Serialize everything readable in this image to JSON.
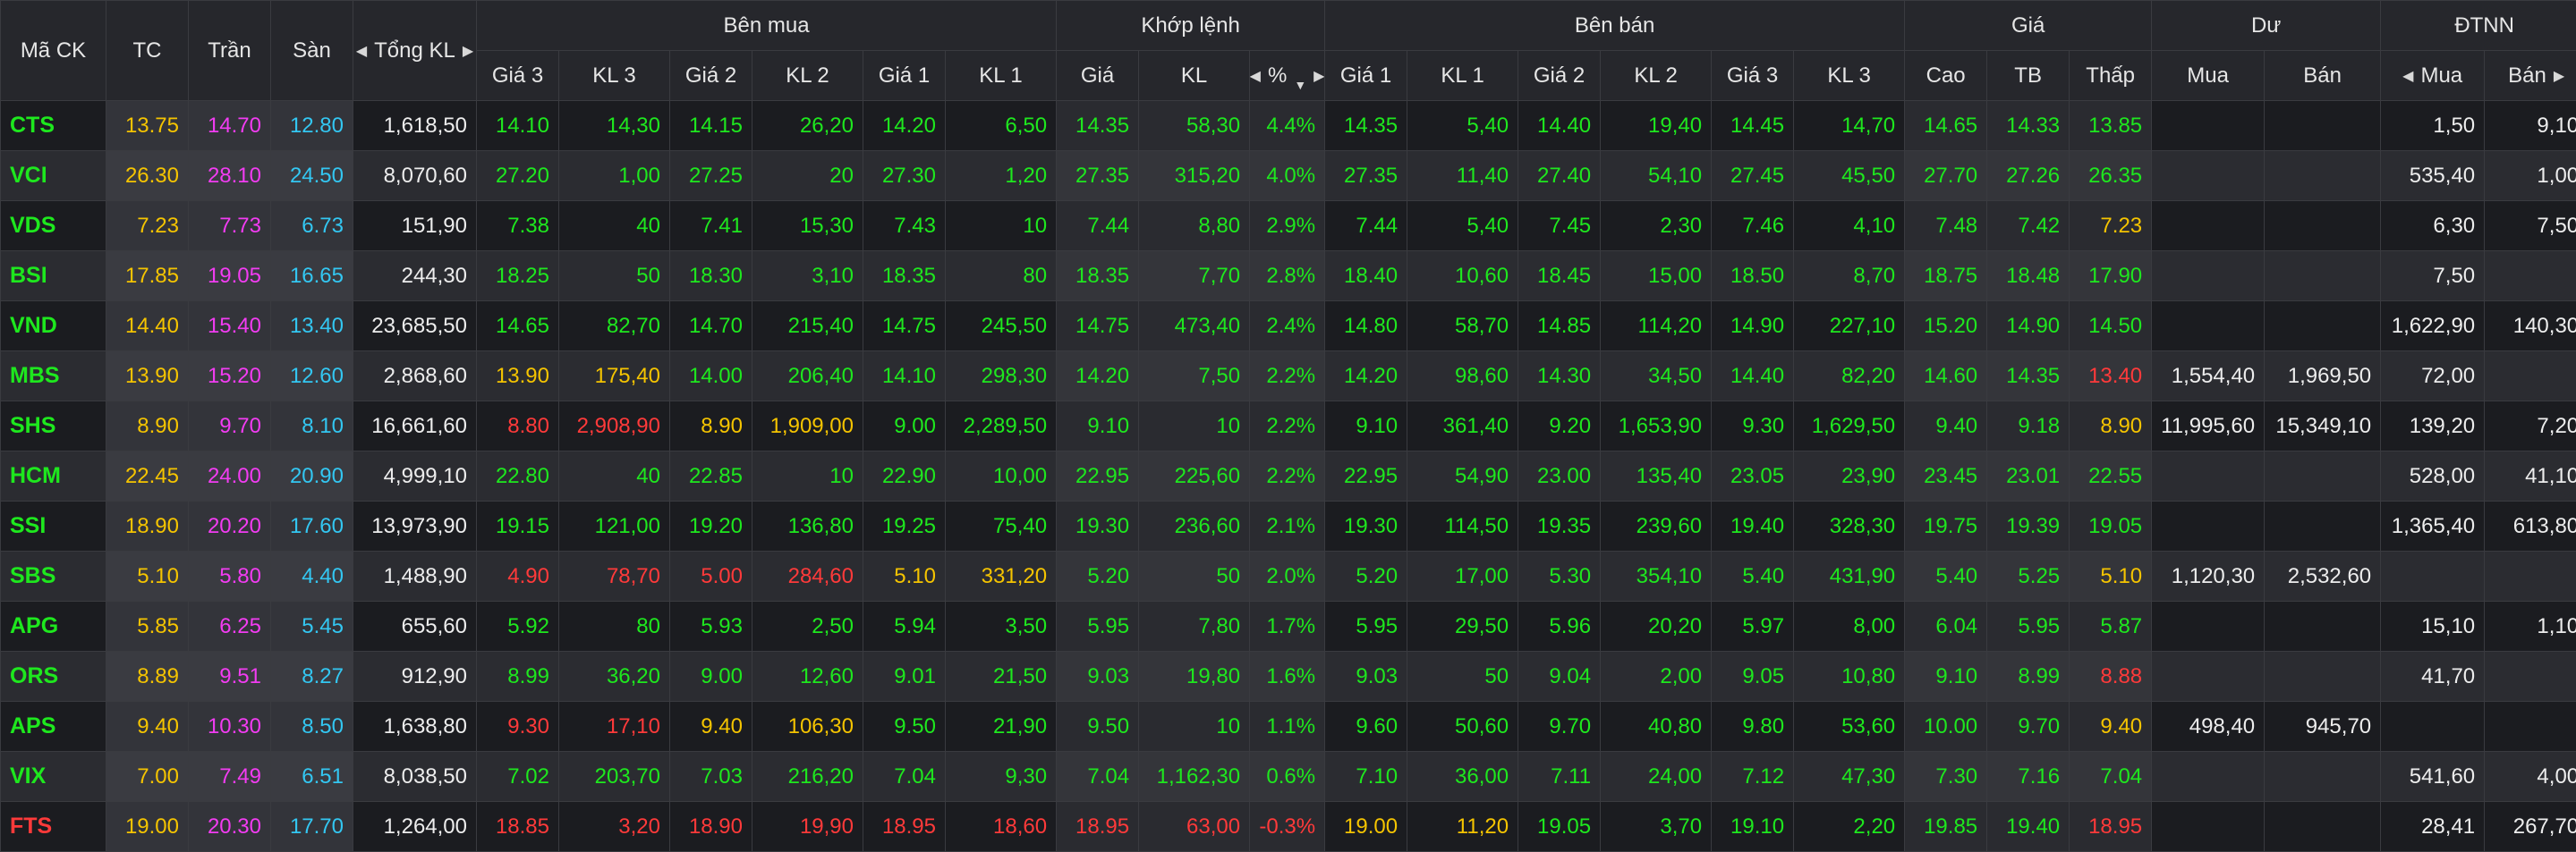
{
  "colors": {
    "up": "#1ee81e",
    "down": "#ff3a3a",
    "reference": "#f5c400",
    "ceiling": "#f23cf2",
    "floor": "#33c7f2",
    "neutral": "#ededed"
  },
  "header": {
    "symbol": "Mã CK",
    "ref": "TC",
    "ceiling": "Trần",
    "floor": "Sàn",
    "total_volume": "Tổng KL",
    "groups": {
      "buy": "Bên mua",
      "match": "Khớp lệnh",
      "sell": "Bên bán",
      "price": "Giá",
      "remain": "Dư",
      "foreign": "ĐTNN"
    },
    "buy_cols": [
      "Giá 3",
      "KL 3",
      "Giá 2",
      "KL 2",
      "Giá 1",
      "KL 1"
    ],
    "match_cols": {
      "price": "Giá",
      "volume": "KL",
      "pct": "%"
    },
    "sell_cols": [
      "Giá 1",
      "KL 1",
      "Giá 2",
      "KL 2",
      "Giá 3",
      "KL 3"
    ],
    "price_cols": [
      "Cao",
      "TB",
      "Thấp"
    ],
    "remain_cols": [
      "Mua",
      "Bán"
    ],
    "foreign_cols": [
      "Mua",
      "Bán"
    ]
  },
  "icons": {
    "scroll_left": "triangle-left-icon",
    "scroll_right": "triangle-right-icon",
    "sort": "sort-down-icon"
  },
  "rows": [
    {
      "sym": "CTS",
      "sym_c": "up",
      "tc": "13.75",
      "tran": "14.70",
      "san": "12.80",
      "tkl": "1,618,50",
      "b3p": "14.10",
      "b3p_c": "up",
      "b3v": "14,30",
      "b3v_c": "up",
      "b2p": "14.15",
      "b2p_c": "up",
      "b2v": "26,20",
      "b2v_c": "up",
      "b1p": "14.20",
      "b1p_c": "up",
      "b1v": "6,50",
      "b1v_c": "up",
      "mp": "14.35",
      "mp_c": "up",
      "mv": "58,30",
      "mv_c": "up",
      "pct": "4.4%",
      "pct_c": "up",
      "s1p": "14.35",
      "s1p_c": "up",
      "s1v": "5,40",
      "s1v_c": "up",
      "s2p": "14.40",
      "s2p_c": "up",
      "s2v": "19,40",
      "s2v_c": "up",
      "s3p": "14.45",
      "s3p_c": "up",
      "s3v": "14,70",
      "s3v_c": "up",
      "hi": "14.65",
      "hi_c": "up",
      "avg": "14.33",
      "avg_c": "up",
      "lo": "13.85",
      "lo_c": "up",
      "rb": "",
      "rs": "",
      "fb": "1,50",
      "fs": "9,10"
    },
    {
      "sym": "VCI",
      "sym_c": "up",
      "tc": "26.30",
      "tran": "28.10",
      "san": "24.50",
      "tkl": "8,070,60",
      "b3p": "27.20",
      "b3p_c": "up",
      "b3v": "1,00",
      "b3v_c": "up",
      "b2p": "27.25",
      "b2p_c": "up",
      "b2v": "20",
      "b2v_c": "up",
      "b1p": "27.30",
      "b1p_c": "up",
      "b1v": "1,20",
      "b1v_c": "up",
      "mp": "27.35",
      "mp_c": "up",
      "mv": "315,20",
      "mv_c": "up",
      "pct": "4.0%",
      "pct_c": "up",
      "s1p": "27.35",
      "s1p_c": "up",
      "s1v": "11,40",
      "s1v_c": "up",
      "s2p": "27.40",
      "s2p_c": "up",
      "s2v": "54,10",
      "s2v_c": "up",
      "s3p": "27.45",
      "s3p_c": "up",
      "s3v": "45,50",
      "s3v_c": "up",
      "hi": "27.70",
      "hi_c": "up",
      "avg": "27.26",
      "avg_c": "up",
      "lo": "26.35",
      "lo_c": "up",
      "rb": "",
      "rs": "",
      "fb": "535,40",
      "fs": "1,00"
    },
    {
      "sym": "VDS",
      "sym_c": "up",
      "tc": "7.23",
      "tran": "7.73",
      "san": "6.73",
      "tkl": "151,90",
      "b3p": "7.38",
      "b3p_c": "up",
      "b3v": "40",
      "b3v_c": "up",
      "b2p": "7.41",
      "b2p_c": "up",
      "b2v": "15,30",
      "b2v_c": "up",
      "b1p": "7.43",
      "b1p_c": "up",
      "b1v": "10",
      "b1v_c": "up",
      "mp": "7.44",
      "mp_c": "up",
      "mv": "8,80",
      "mv_c": "up",
      "pct": "2.9%",
      "pct_c": "up",
      "s1p": "7.44",
      "s1p_c": "up",
      "s1v": "5,40",
      "s1v_c": "up",
      "s2p": "7.45",
      "s2p_c": "up",
      "s2v": "2,30",
      "s2v_c": "up",
      "s3p": "7.46",
      "s3p_c": "up",
      "s3v": "4,10",
      "s3v_c": "up",
      "hi": "7.48",
      "hi_c": "up",
      "avg": "7.42",
      "avg_c": "up",
      "lo": "7.23",
      "lo_c": "ref",
      "rb": "",
      "rs": "",
      "fb": "6,30",
      "fs": "7,50"
    },
    {
      "sym": "BSI",
      "sym_c": "up",
      "tc": "17.85",
      "tran": "19.05",
      "san": "16.65",
      "tkl": "244,30",
      "b3p": "18.25",
      "b3p_c": "up",
      "b3v": "50",
      "b3v_c": "up",
      "b2p": "18.30",
      "b2p_c": "up",
      "b2v": "3,10",
      "b2v_c": "up",
      "b1p": "18.35",
      "b1p_c": "up",
      "b1v": "80",
      "b1v_c": "up",
      "mp": "18.35",
      "mp_c": "up",
      "mv": "7,70",
      "mv_c": "up",
      "pct": "2.8%",
      "pct_c": "up",
      "s1p": "18.40",
      "s1p_c": "up",
      "s1v": "10,60",
      "s1v_c": "up",
      "s2p": "18.45",
      "s2p_c": "up",
      "s2v": "15,00",
      "s2v_c": "up",
      "s3p": "18.50",
      "s3p_c": "up",
      "s3v": "8,70",
      "s3v_c": "up",
      "hi": "18.75",
      "hi_c": "up",
      "avg": "18.48",
      "avg_c": "up",
      "lo": "17.90",
      "lo_c": "up",
      "rb": "",
      "rs": "",
      "fb": "7,50",
      "fs": ""
    },
    {
      "sym": "VND",
      "sym_c": "up",
      "tc": "14.40",
      "tran": "15.40",
      "san": "13.40",
      "tkl": "23,685,50",
      "b3p": "14.65",
      "b3p_c": "up",
      "b3v": "82,70",
      "b3v_c": "up",
      "b2p": "14.70",
      "b2p_c": "up",
      "b2v": "215,40",
      "b2v_c": "up",
      "b1p": "14.75",
      "b1p_c": "up",
      "b1v": "245,50",
      "b1v_c": "up",
      "mp": "14.75",
      "mp_c": "up",
      "mv": "473,40",
      "mv_c": "up",
      "pct": "2.4%",
      "pct_c": "up",
      "s1p": "14.80",
      "s1p_c": "up",
      "s1v": "58,70",
      "s1v_c": "up",
      "s2p": "14.85",
      "s2p_c": "up",
      "s2v": "114,20",
      "s2v_c": "up",
      "s3p": "14.90",
      "s3p_c": "up",
      "s3v": "227,10",
      "s3v_c": "up",
      "hi": "15.20",
      "hi_c": "up",
      "avg": "14.90",
      "avg_c": "up",
      "lo": "14.50",
      "lo_c": "up",
      "rb": "",
      "rs": "",
      "fb": "1,622,90",
      "fs": "140,30"
    },
    {
      "sym": "MBS",
      "sym_c": "up",
      "tc": "13.90",
      "tran": "15.20",
      "san": "12.60",
      "tkl": "2,868,60",
      "b3p": "13.90",
      "b3p_c": "ref",
      "b3v": "175,40",
      "b3v_c": "ref",
      "b2p": "14.00",
      "b2p_c": "up",
      "b2v": "206,40",
      "b2v_c": "up",
      "b1p": "14.10",
      "b1p_c": "up",
      "b1v": "298,30",
      "b1v_c": "up",
      "mp": "14.20",
      "mp_c": "up",
      "mv": "7,50",
      "mv_c": "up",
      "pct": "2.2%",
      "pct_c": "up",
      "s1p": "14.20",
      "s1p_c": "up",
      "s1v": "98,60",
      "s1v_c": "up",
      "s2p": "14.30",
      "s2p_c": "up",
      "s2v": "34,50",
      "s2v_c": "up",
      "s3p": "14.40",
      "s3p_c": "up",
      "s3v": "82,20",
      "s3v_c": "up",
      "hi": "14.60",
      "hi_c": "up",
      "avg": "14.35",
      "avg_c": "up",
      "lo": "13.40",
      "lo_c": "down",
      "rb": "1,554,40",
      "rs": "1,969,50",
      "fb": "72,00",
      "fs": ""
    },
    {
      "sym": "SHS",
      "sym_c": "up",
      "tc": "8.90",
      "tran": "9.70",
      "san": "8.10",
      "tkl": "16,661,60",
      "b3p": "8.80",
      "b3p_c": "down",
      "b3v": "2,908,90",
      "b3v_c": "down",
      "b2p": "8.90",
      "b2p_c": "ref",
      "b2v": "1,909,00",
      "b2v_c": "ref",
      "b1p": "9.00",
      "b1p_c": "up",
      "b1v": "2,289,50",
      "b1v_c": "up",
      "mp": "9.10",
      "mp_c": "up",
      "mv": "10",
      "mv_c": "up",
      "pct": "2.2%",
      "pct_c": "up",
      "s1p": "9.10",
      "s1p_c": "up",
      "s1v": "361,40",
      "s1v_c": "up",
      "s2p": "9.20",
      "s2p_c": "up",
      "s2v": "1,653,90",
      "s2v_c": "up",
      "s3p": "9.30",
      "s3p_c": "up",
      "s3v": "1,629,50",
      "s3v_c": "up",
      "hi": "9.40",
      "hi_c": "up",
      "avg": "9.18",
      "avg_c": "up",
      "lo": "8.90",
      "lo_c": "ref",
      "rb": "11,995,60",
      "rs": "15,349,10",
      "fb": "139,20",
      "fs": "7,20"
    },
    {
      "sym": "HCM",
      "sym_c": "up",
      "tc": "22.45",
      "tran": "24.00",
      "san": "20.90",
      "tkl": "4,999,10",
      "b3p": "22.80",
      "b3p_c": "up",
      "b3v": "40",
      "b3v_c": "up",
      "b2p": "22.85",
      "b2p_c": "up",
      "b2v": "10",
      "b2v_c": "up",
      "b1p": "22.90",
      "b1p_c": "up",
      "b1v": "10,00",
      "b1v_c": "up",
      "mp": "22.95",
      "mp_c": "up",
      "mv": "225,60",
      "mv_c": "up",
      "pct": "2.2%",
      "pct_c": "up",
      "s1p": "22.95",
      "s1p_c": "up",
      "s1v": "54,90",
      "s1v_c": "up",
      "s2p": "23.00",
      "s2p_c": "up",
      "s2v": "135,40",
      "s2v_c": "up",
      "s3p": "23.05",
      "s3p_c": "up",
      "s3v": "23,90",
      "s3v_c": "up",
      "hi": "23.45",
      "hi_c": "up",
      "avg": "23.01",
      "avg_c": "up",
      "lo": "22.55",
      "lo_c": "up",
      "rb": "",
      "rs": "",
      "fb": "528,00",
      "fs": "41,10"
    },
    {
      "sym": "SSI",
      "sym_c": "up",
      "tc": "18.90",
      "tran": "20.20",
      "san": "17.60",
      "tkl": "13,973,90",
      "b3p": "19.15",
      "b3p_c": "up",
      "b3v": "121,00",
      "b3v_c": "up",
      "b2p": "19.20",
      "b2p_c": "up",
      "b2v": "136,80",
      "b2v_c": "up",
      "b1p": "19.25",
      "b1p_c": "up",
      "b1v": "75,40",
      "b1v_c": "up",
      "mp": "19.30",
      "mp_c": "up",
      "mv": "236,60",
      "mv_c": "up",
      "pct": "2.1%",
      "pct_c": "up",
      "s1p": "19.30",
      "s1p_c": "up",
      "s1v": "114,50",
      "s1v_c": "up",
      "s2p": "19.35",
      "s2p_c": "up",
      "s2v": "239,60",
      "s2v_c": "up",
      "s3p": "19.40",
      "s3p_c": "up",
      "s3v": "328,30",
      "s3v_c": "up",
      "hi": "19.75",
      "hi_c": "up",
      "avg": "19.39",
      "avg_c": "up",
      "lo": "19.05",
      "lo_c": "up",
      "rb": "",
      "rs": "",
      "fb": "1,365,40",
      "fs": "613,80"
    },
    {
      "sym": "SBS",
      "sym_c": "up",
      "tc": "5.10",
      "tran": "5.80",
      "san": "4.40",
      "tkl": "1,488,90",
      "b3p": "4.90",
      "b3p_c": "down",
      "b3v": "78,70",
      "b3v_c": "down",
      "b2p": "5.00",
      "b2p_c": "down",
      "b2v": "284,60",
      "b2v_c": "down",
      "b1p": "5.10",
      "b1p_c": "ref",
      "b1v": "331,20",
      "b1v_c": "ref",
      "mp": "5.20",
      "mp_c": "up",
      "mv": "50",
      "mv_c": "up",
      "pct": "2.0%",
      "pct_c": "up",
      "s1p": "5.20",
      "s1p_c": "up",
      "s1v": "17,00",
      "s1v_c": "up",
      "s2p": "5.30",
      "s2p_c": "up",
      "s2v": "354,10",
      "s2v_c": "up",
      "s3p": "5.40",
      "s3p_c": "up",
      "s3v": "431,90",
      "s3v_c": "up",
      "hi": "5.40",
      "hi_c": "up",
      "avg": "5.25",
      "avg_c": "up",
      "lo": "5.10",
      "lo_c": "ref",
      "rb": "1,120,30",
      "rs": "2,532,60",
      "fb": "",
      "fs": ""
    },
    {
      "sym": "APG",
      "sym_c": "up",
      "tc": "5.85",
      "tran": "6.25",
      "san": "5.45",
      "tkl": "655,60",
      "b3p": "5.92",
      "b3p_c": "up",
      "b3v": "80",
      "b3v_c": "up",
      "b2p": "5.93",
      "b2p_c": "up",
      "b2v": "2,50",
      "b2v_c": "up",
      "b1p": "5.94",
      "b1p_c": "up",
      "b1v": "3,50",
      "b1v_c": "up",
      "mp": "5.95",
      "mp_c": "up",
      "mv": "7,80",
      "mv_c": "up",
      "pct": "1.7%",
      "pct_c": "up",
      "s1p": "5.95",
      "s1p_c": "up",
      "s1v": "29,50",
      "s1v_c": "up",
      "s2p": "5.96",
      "s2p_c": "up",
      "s2v": "20,20",
      "s2v_c": "up",
      "s3p": "5.97",
      "s3p_c": "up",
      "s3v": "8,00",
      "s3v_c": "up",
      "hi": "6.04",
      "hi_c": "up",
      "avg": "5.95",
      "avg_c": "up",
      "lo": "5.87",
      "lo_c": "up",
      "rb": "",
      "rs": "",
      "fb": "15,10",
      "fs": "1,10"
    },
    {
      "sym": "ORS",
      "sym_c": "up",
      "tc": "8.89",
      "tran": "9.51",
      "san": "8.27",
      "tkl": "912,90",
      "b3p": "8.99",
      "b3p_c": "up",
      "b3v": "36,20",
      "b3v_c": "up",
      "b2p": "9.00",
      "b2p_c": "up",
      "b2v": "12,60",
      "b2v_c": "up",
      "b1p": "9.01",
      "b1p_c": "up",
      "b1v": "21,50",
      "b1v_c": "up",
      "mp": "9.03",
      "mp_c": "up",
      "mv": "19,80",
      "mv_c": "up",
      "pct": "1.6%",
      "pct_c": "up",
      "s1p": "9.03",
      "s1p_c": "up",
      "s1v": "50",
      "s1v_c": "up",
      "s2p": "9.04",
      "s2p_c": "up",
      "s2v": "2,00",
      "s2v_c": "up",
      "s3p": "9.05",
      "s3p_c": "up",
      "s3v": "10,80",
      "s3v_c": "up",
      "hi": "9.10",
      "hi_c": "up",
      "avg": "8.99",
      "avg_c": "up",
      "lo": "8.88",
      "lo_c": "down",
      "rb": "",
      "rs": "",
      "fb": "41,70",
      "fs": ""
    },
    {
      "sym": "APS",
      "sym_c": "up",
      "tc": "9.40",
      "tran": "10.30",
      "san": "8.50",
      "tkl": "1,638,80",
      "b3p": "9.30",
      "b3p_c": "down",
      "b3v": "17,10",
      "b3v_c": "down",
      "b2p": "9.40",
      "b2p_c": "ref",
      "b2v": "106,30",
      "b2v_c": "ref",
      "b1p": "9.50",
      "b1p_c": "up",
      "b1v": "21,90",
      "b1v_c": "up",
      "mp": "9.50",
      "mp_c": "up",
      "mv": "10",
      "mv_c": "up",
      "pct": "1.1%",
      "pct_c": "up",
      "s1p": "9.60",
      "s1p_c": "up",
      "s1v": "50,60",
      "s1v_c": "up",
      "s2p": "9.70",
      "s2p_c": "up",
      "s2v": "40,80",
      "s2v_c": "up",
      "s3p": "9.80",
      "s3p_c": "up",
      "s3v": "53,60",
      "s3v_c": "up",
      "hi": "10.00",
      "hi_c": "up",
      "avg": "9.70",
      "avg_c": "up",
      "lo": "9.40",
      "lo_c": "ref",
      "rb": "498,40",
      "rs": "945,70",
      "fb": "",
      "fs": ""
    },
    {
      "sym": "VIX",
      "sym_c": "up",
      "tc": "7.00",
      "tran": "7.49",
      "san": "6.51",
      "tkl": "8,038,50",
      "b3p": "7.02",
      "b3p_c": "up",
      "b3v": "203,70",
      "b3v_c": "up",
      "b2p": "7.03",
      "b2p_c": "up",
      "b2v": "216,20",
      "b2v_c": "up",
      "b1p": "7.04",
      "b1p_c": "up",
      "b1v": "9,30",
      "b1v_c": "up",
      "mp": "7.04",
      "mp_c": "up",
      "mv": "1,162,30",
      "mv_c": "up",
      "pct": "0.6%",
      "pct_c": "up",
      "s1p": "7.10",
      "s1p_c": "up",
      "s1v": "36,00",
      "s1v_c": "up",
      "s2p": "7.11",
      "s2p_c": "up",
      "s2v": "24,00",
      "s2v_c": "up",
      "s3p": "7.12",
      "s3p_c": "up",
      "s3v": "47,30",
      "s3v_c": "up",
      "hi": "7.30",
      "hi_c": "up",
      "avg": "7.16",
      "avg_c": "up",
      "lo": "7.04",
      "lo_c": "up",
      "rb": "",
      "rs": "",
      "fb": "541,60",
      "fs": "4,00"
    },
    {
      "sym": "FTS",
      "sym_c": "down",
      "tc": "19.00",
      "tran": "20.30",
      "san": "17.70",
      "tkl": "1,264,00",
      "b3p": "18.85",
      "b3p_c": "down",
      "b3v": "3,20",
      "b3v_c": "down",
      "b2p": "18.90",
      "b2p_c": "down",
      "b2v": "19,90",
      "b2v_c": "down",
      "b1p": "18.95",
      "b1p_c": "down",
      "b1v": "18,60",
      "b1v_c": "down",
      "mp": "18.95",
      "mp_c": "down",
      "mv": "63,00",
      "mv_c": "down",
      "pct": "-0.3%",
      "pct_c": "down",
      "s1p": "19.00",
      "s1p_c": "ref",
      "s1v": "11,20",
      "s1v_c": "ref",
      "s2p": "19.05",
      "s2p_c": "up",
      "s2v": "3,70",
      "s2v_c": "up",
      "s3p": "19.10",
      "s3p_c": "up",
      "s3v": "2,20",
      "s3v_c": "up",
      "hi": "19.85",
      "hi_c": "up",
      "avg": "19.40",
      "avg_c": "up",
      "lo": "18.95",
      "lo_c": "down",
      "rb": "",
      "rs": "",
      "fb": "28,41",
      "fs": "267,70"
    }
  ]
}
